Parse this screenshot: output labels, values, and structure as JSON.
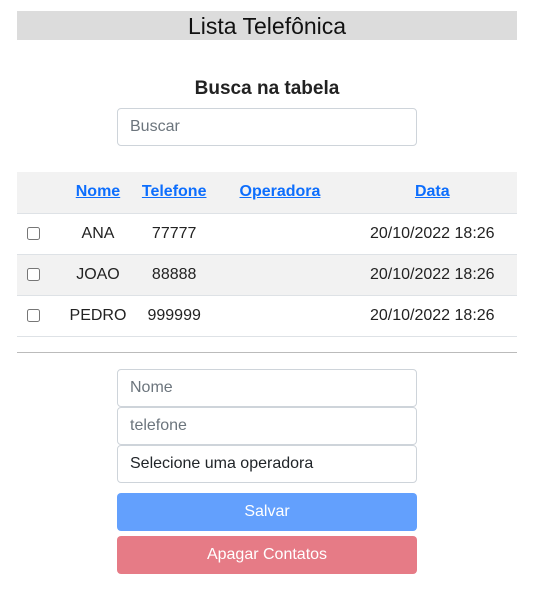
{
  "header": {
    "title": "Lista Telefônica"
  },
  "search": {
    "heading": "Busca na tabela",
    "placeholder": "Buscar",
    "value": ""
  },
  "table": {
    "columns": [
      "Nome",
      "Telefone",
      "Operadora",
      "Data"
    ],
    "rows": [
      {
        "nome": "ANA",
        "telefone": "77777",
        "operadora": "",
        "data": "20/10/2022 18:26",
        "checked": false
      },
      {
        "nome": "JOAO",
        "telefone": "88888",
        "operadora": "",
        "data": "20/10/2022 18:26",
        "checked": false
      },
      {
        "nome": "PEDRO",
        "telefone": "999999",
        "operadora": "",
        "data": "20/10/2022 18:26",
        "checked": false
      }
    ]
  },
  "form": {
    "nome_placeholder": "Nome",
    "telefone_placeholder": "telefone",
    "operadora_selected": "Selecione uma operadora",
    "save_label": "Salvar",
    "delete_label": "Apagar Contatos"
  },
  "colors": {
    "title_bg": "#dcdcdc",
    "link": "#0d6efd",
    "save_button": "#63a0fd",
    "delete_button": "#e67b86",
    "striped_row": "#f2f2f2"
  }
}
